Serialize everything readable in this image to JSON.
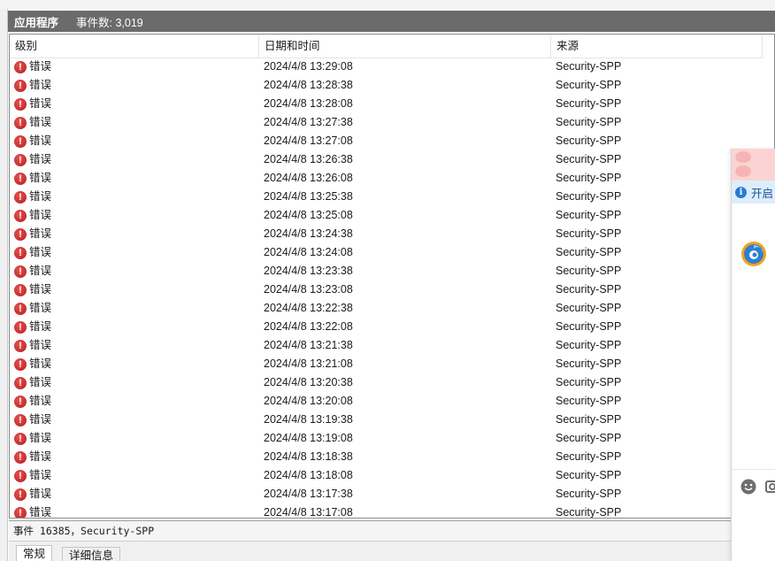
{
  "header": {
    "title": "应用程序",
    "event_count": "事件数: 3,019"
  },
  "columns": {
    "level": "级别",
    "datetime": "日期和时间",
    "source": "来源"
  },
  "rows": [
    {
      "level": "错误",
      "datetime": "2024/4/8 13:29:08",
      "source": "Security-SPP"
    },
    {
      "level": "错误",
      "datetime": "2024/4/8 13:28:38",
      "source": "Security-SPP"
    },
    {
      "level": "错误",
      "datetime": "2024/4/8 13:28:08",
      "source": "Security-SPP"
    },
    {
      "level": "错误",
      "datetime": "2024/4/8 13:27:38",
      "source": "Security-SPP"
    },
    {
      "level": "错误",
      "datetime": "2024/4/8 13:27:08",
      "source": "Security-SPP"
    },
    {
      "level": "错误",
      "datetime": "2024/4/8 13:26:38",
      "source": "Security-SPP"
    },
    {
      "level": "错误",
      "datetime": "2024/4/8 13:26:08",
      "source": "Security-SPP"
    },
    {
      "level": "错误",
      "datetime": "2024/4/8 13:25:38",
      "source": "Security-SPP"
    },
    {
      "level": "错误",
      "datetime": "2024/4/8 13:25:08",
      "source": "Security-SPP"
    },
    {
      "level": "错误",
      "datetime": "2024/4/8 13:24:38",
      "source": "Security-SPP"
    },
    {
      "level": "错误",
      "datetime": "2024/4/8 13:24:08",
      "source": "Security-SPP"
    },
    {
      "level": "错误",
      "datetime": "2024/4/8 13:23:38",
      "source": "Security-SPP"
    },
    {
      "level": "错误",
      "datetime": "2024/4/8 13:23:08",
      "source": "Security-SPP"
    },
    {
      "level": "错误",
      "datetime": "2024/4/8 13:22:38",
      "source": "Security-SPP"
    },
    {
      "level": "错误",
      "datetime": "2024/4/8 13:22:08",
      "source": "Security-SPP"
    },
    {
      "level": "错误",
      "datetime": "2024/4/8 13:21:38",
      "source": "Security-SPP"
    },
    {
      "level": "错误",
      "datetime": "2024/4/8 13:21:08",
      "source": "Security-SPP"
    },
    {
      "level": "错误",
      "datetime": "2024/4/8 13:20:38",
      "source": "Security-SPP"
    },
    {
      "level": "错误",
      "datetime": "2024/4/8 13:20:08",
      "source": "Security-SPP"
    },
    {
      "level": "错误",
      "datetime": "2024/4/8 13:19:38",
      "source": "Security-SPP"
    },
    {
      "level": "错误",
      "datetime": "2024/4/8 13:19:08",
      "source": "Security-SPP"
    },
    {
      "level": "错误",
      "datetime": "2024/4/8 13:18:38",
      "source": "Security-SPP"
    },
    {
      "level": "错误",
      "datetime": "2024/4/8 13:18:08",
      "source": "Security-SPP"
    },
    {
      "level": "错误",
      "datetime": "2024/4/8 13:17:38",
      "source": "Security-SPP"
    },
    {
      "level": "错误",
      "datetime": "2024/4/8 13:17:08",
      "source": "Security-SPP"
    }
  ],
  "icons": {
    "row_level": "error-icon"
  },
  "detail": {
    "text": "事件 16385，Security-SPP"
  },
  "tabs": {
    "general": "常规",
    "details": "详细信息"
  },
  "overlay": {
    "info_text": "开启",
    "icons": [
      "info-icon",
      "app-logo-icon",
      "emoji-icon",
      "screenshot-icon"
    ]
  },
  "colors": {
    "header_bg": "#6b6b6b",
    "error_red": "#c4302b",
    "info_blue": "#2a79d6",
    "overlay_pink": "#fcd3d3"
  }
}
